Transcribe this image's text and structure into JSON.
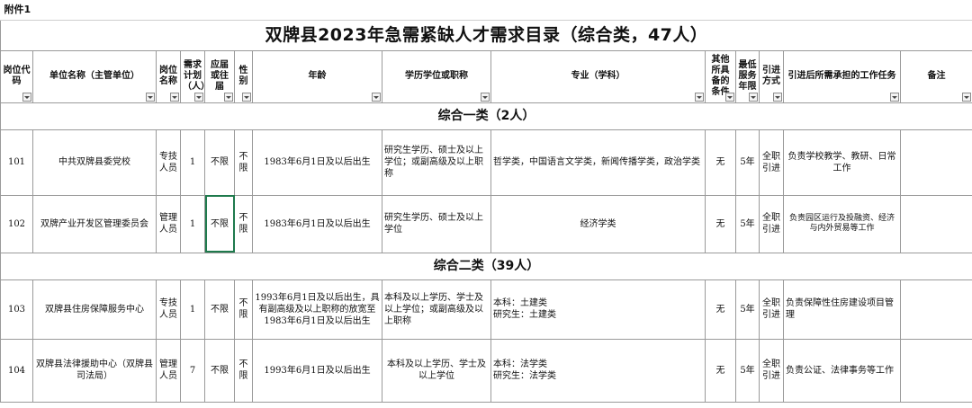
{
  "attachment_label": "附件1",
  "title": "双牌县2023年急需紧缺人才需求目录（综合类，47人）",
  "columns": [
    "岗位代码",
    "单位名称（主管单位）",
    "岗位名称",
    "需求计划（人）",
    "应届或往届",
    "性别",
    "年龄",
    "学历学位或职称",
    "专业（学科）",
    "其他所具备的条件",
    "最低服务年限",
    "引进方式",
    "引进后所需承担的工作任务",
    "备注"
  ],
  "sections": [
    {
      "label": "综合一类（2人）",
      "rows": [
        {
          "code": "101",
          "unit": "中共双牌县委党校",
          "post": "专技人员",
          "count": "1",
          "fresh": "不限",
          "gender": "不限",
          "age": "1983年6月1日及以后出生",
          "education": "研究生学历、硕士及以上学位；或副高级及以上职称",
          "major": "哲学类，中国语言文学类，新闻传播学类，政治学类",
          "other": "无",
          "years": "5年",
          "method": "全职引进",
          "duty": "负责学校教学、教研、日常工作",
          "note": ""
        },
        {
          "code": "102",
          "unit": "双牌产业开发区管理委员会",
          "post": "管理人员",
          "count": "1",
          "fresh": "不限",
          "gender": "不限",
          "age": "1983年6月1日及以后出生",
          "education": "研究生学历、硕士及以上学位",
          "major": "经济学类",
          "other": "无",
          "years": "5年",
          "method": "全职引进",
          "duty": "负责园区运行及投融资、经济与内外贸易等工作",
          "note": ""
        }
      ]
    },
    {
      "label": "综合二类（39人）",
      "rows": [
        {
          "code": "103",
          "unit": "双牌县住房保障服务中心",
          "post": "专技人员",
          "count": "1",
          "fresh": "不限",
          "gender": "不限",
          "age": "1993年6月1日及以后出生，具有副高级及以上职称的放宽至1983年6月1日及以后出生",
          "education": "本科及以上学历、学士及以上学位；或副高级及以上职称",
          "major_line1": "本科：土建类",
          "major_line2": "研究生：土建类",
          "other": "无",
          "years": "5年",
          "method": "全职引进",
          "duty": "负责保障性住房建设项目管理",
          "note": ""
        },
        {
          "code": "104",
          "unit": "双牌县法律援助中心（双牌县司法局）",
          "post": "管理人员",
          "count": "7",
          "fresh": "不限",
          "gender": "不限",
          "age": "1993年6月1日及以后出生",
          "education": "本科及以上学历、学士及以上学位",
          "major_line1": "本科：法学类",
          "major_line2": "研究生：法学类",
          "other": "无",
          "years": "5年",
          "method": "全职引进",
          "duty": "负责公证、法律事务等工作",
          "note": ""
        }
      ]
    }
  ]
}
